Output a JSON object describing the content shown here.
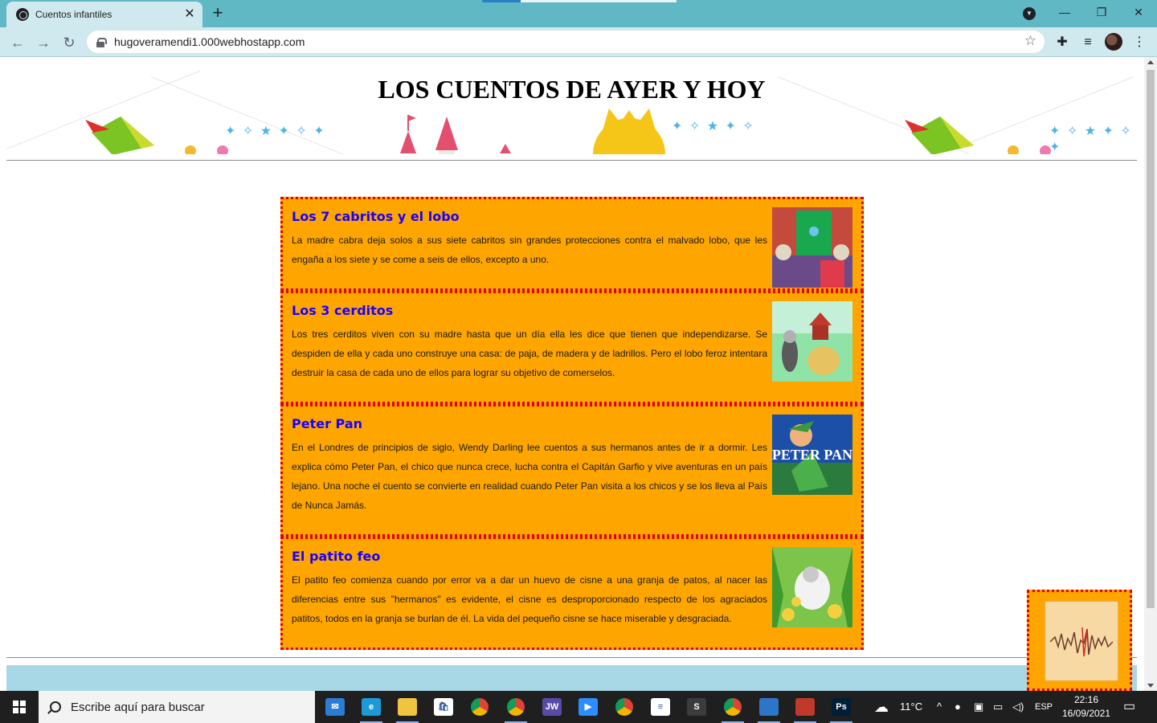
{
  "browser": {
    "tab_title": "Cuentos infantiles",
    "tab_close": "✕",
    "new_tab": "+",
    "url": "hugoveramendi1.000webhostapp.com",
    "window_controls": {
      "minimize": "—",
      "restore": "❐",
      "close": "✕"
    }
  },
  "page": {
    "title": "LOS CUENTOS DE AYER Y HOY",
    "stories": [
      {
        "title": "Los 7 cabritos y el lobo",
        "text": "La madre cabra deja solos a sus siete cabritos sin grandes protecciones contra el malvado lobo, que les engaña a los siete y se come a seis de ellos, excepto a uno."
      },
      {
        "title": "Los 3 cerditos",
        "text": "Los tres cerditos viven con su madre hasta que un día ella les dice que tienen que independizarse. Se despiden de ella y cada uno construye una casa: de paja, de madera y de ladrillos. Pero el lobo feroz intentara destruir la casa de cada uno de ellos para lograr su objetivo de comerselos."
      },
      {
        "title": "Peter Pan",
        "text": "En el Londres de principios de siglo, Wendy Darling lee cuentos a sus hermanos antes de ir a dormir. Les explica cómo Peter Pan, el chico que nunca crece, lucha contra el Capitán Garfio y vive aventuras en un país lejano. Una noche el cuento se convierte en realidad cuando Peter Pan visita a los chicos y se los lleva al País de Nunca Jamás.",
        "image_caption": "PETER PAN"
      },
      {
        "title": "El patito feo",
        "text": "El patito feo comienza cuando por error va a dar un huevo de cisne a una granja de patos, al nacer las diferencias entre sus \"hermanos\" es evidente, el cisne es desproporcionado respecto de los agraciados patitos, todos en la granja se burlan de él. La vida del pequeño cisne se hace miserable y desgraciada."
      }
    ]
  },
  "taskbar": {
    "search_placeholder": "Escribe aquí para buscar",
    "apps": [
      {
        "name": "mail",
        "label": "✉",
        "color": "#2b7cd3"
      },
      {
        "name": "edge",
        "label": "e",
        "color": "#1e9bd7"
      },
      {
        "name": "file-explorer",
        "label": "",
        "color": "#f0c341"
      },
      {
        "name": "store",
        "label": "🛍",
        "color": "#ffffff"
      },
      {
        "name": "chrome",
        "label": "",
        "color": "#dd4b39"
      },
      {
        "name": "chrome-profile",
        "label": "",
        "color": "#dd4b39"
      },
      {
        "name": "jw",
        "label": "JW",
        "color": "#5a4aa8"
      },
      {
        "name": "zoom",
        "label": "▶",
        "color": "#2d8cff"
      },
      {
        "name": "chrome-2",
        "label": "",
        "color": "#dd4b39"
      },
      {
        "name": "docs",
        "label": "≡",
        "color": "#ffffff"
      },
      {
        "name": "sublime",
        "label": "S",
        "color": "#3c3c3c"
      },
      {
        "name": "chrome-active",
        "label": "",
        "color": "#dd4b39"
      },
      {
        "name": "photos",
        "label": "",
        "color": "#2c76c9"
      },
      {
        "name": "tool",
        "label": "",
        "color": "#c0392b"
      },
      {
        "name": "photoshop",
        "label": "Ps",
        "color": "#001e36"
      }
    ],
    "weather": "11°C",
    "language": "ESP",
    "time": "22:16",
    "date": "16/09/2021"
  },
  "colors": {
    "story_bg": "#ffa500",
    "story_border": "#e30000",
    "story_title": "#1a00ff",
    "footer": "#a8d8e6",
    "tabbar": "#5fb8c4"
  }
}
